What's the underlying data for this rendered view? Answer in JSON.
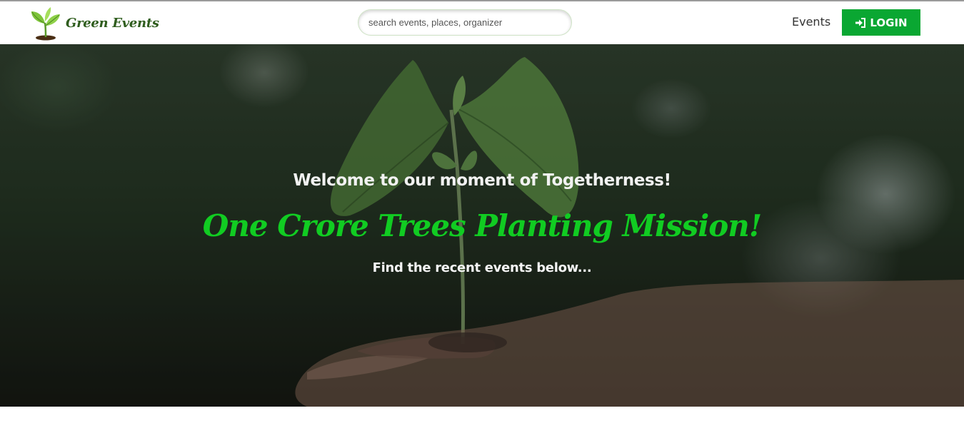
{
  "header": {
    "brand_name": "Green Events",
    "logo_icon": "sprout-icon",
    "search": {
      "placeholder": "search events, places, organizer",
      "value": ""
    },
    "nav": {
      "events_label": "Events"
    },
    "login": {
      "label": "LOGIN",
      "icon": "sign-in-icon"
    }
  },
  "hero": {
    "welcome": "Welcome to our moment of Togetherness!",
    "mission": "One Crore Trees Planting Mission!",
    "subtitle": "Find the recent events below..."
  },
  "colors": {
    "brand_green": "#0aa732",
    "mission_green": "#11cc22",
    "brand_text": "#2f5d1e"
  }
}
